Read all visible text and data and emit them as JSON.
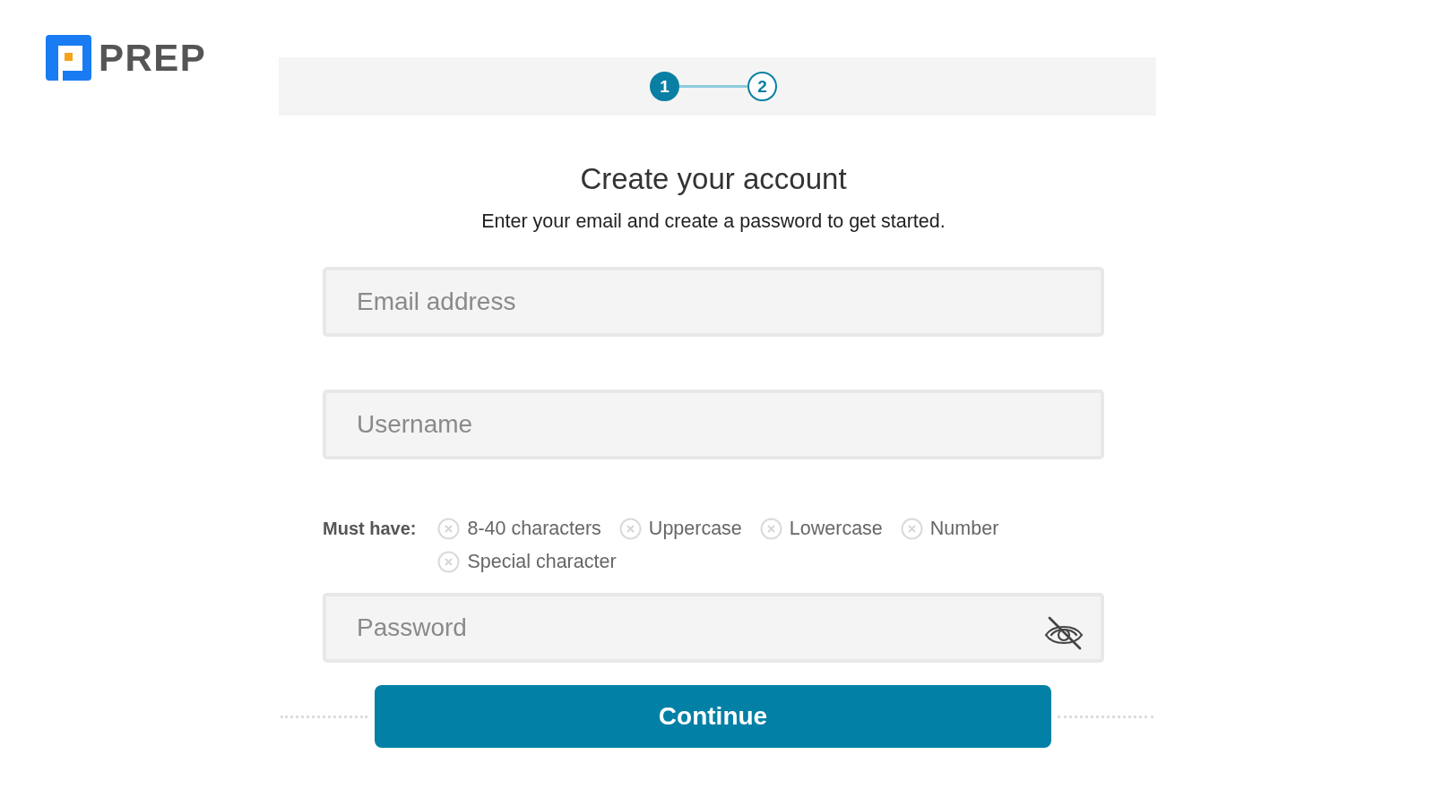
{
  "logo": {
    "text": "PREP"
  },
  "stepper": {
    "steps": [
      {
        "label": "1",
        "active": true
      },
      {
        "label": "2",
        "active": false
      }
    ]
  },
  "heading": "Create your account",
  "subheading": "Enter your email and create a password to get started.",
  "email_field": {
    "placeholder": "Email address"
  },
  "username_field": {
    "placeholder": "Username"
  },
  "password_requirements": {
    "label": "Must have:",
    "items": [
      {
        "text": "8-40 characters",
        "met": false
      },
      {
        "text": "Uppercase",
        "met": false
      },
      {
        "text": "Lowercase",
        "met": false
      },
      {
        "text": "Number",
        "met": false
      },
      {
        "text": "Special character",
        "met": false
      }
    ]
  },
  "password_field": {
    "placeholder": "Password",
    "visible": false
  },
  "continue_button": "Continue"
}
